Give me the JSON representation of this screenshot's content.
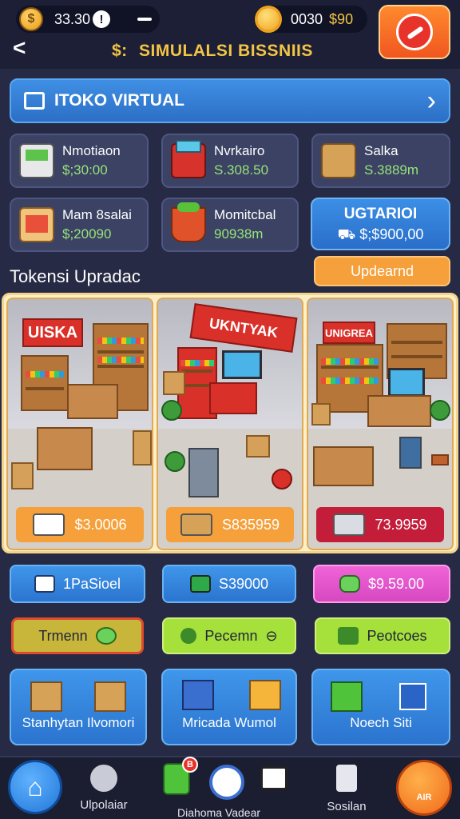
{
  "status": {
    "coins": "33.30",
    "coin_symbol": "$",
    "alert_symbol": "!",
    "gems": "0030",
    "gems_extra": "$90"
  },
  "header": {
    "back_symbol": "<",
    "title_prefix": "$:",
    "title": "SIMULALSI BISSNIIS"
  },
  "banner": {
    "title": "ITOKO VIRTUAL",
    "chevron": "›"
  },
  "stats": [
    {
      "name": "Nmotiaon",
      "value": "$;30:00",
      "icon": "cart-icon"
    },
    {
      "name": "Nvrkairo",
      "value": "S.308.50",
      "icon": "basket-icon"
    },
    {
      "name": "Salka",
      "value": "S.3889m",
      "icon": "box-icon"
    },
    {
      "name": "Mam 8salai",
      "value": "$;20090",
      "icon": "shop-icon"
    },
    {
      "name": "Momitcbal",
      "value": "90938m",
      "icon": "produce-icon"
    }
  ],
  "upgrade_card": {
    "title": "UGTARIOI",
    "value": "$;$900,00",
    "icon_symbol": "⛟"
  },
  "section": {
    "title": "Tokensi Upradac",
    "button": "Updearnd"
  },
  "stores": [
    {
      "sign": "UISKA",
      "price": "$3.0006",
      "color": "#f5a03a"
    },
    {
      "sign": "UKNTYAK",
      "price": "S835959",
      "color": "#f5a03a"
    },
    {
      "sign": "UNIGREA",
      "price": "73.9959",
      "color": "#c41d3a"
    }
  ],
  "actions_row1": [
    {
      "label": "1PaSioel",
      "icon": "list-icon"
    },
    {
      "label": "S39000",
      "icon": "chart-icon"
    },
    {
      "label": "$9.59.00",
      "icon": "bag-icon"
    }
  ],
  "actions_row2": [
    {
      "label": "Trmenn",
      "icon": "map-icon"
    },
    {
      "label": "Pecemn",
      "icon": "key-icon",
      "suffix": "⊖"
    },
    {
      "label": "Peotcoes",
      "icon": "puzzle-icon"
    }
  ],
  "big_buttons": [
    {
      "label": "Stanhytan Ilvomori",
      "icon": "crates-icon"
    },
    {
      "label": "Mricada Wumol",
      "icon": "device-icon"
    },
    {
      "label": "Noech Siti",
      "icon": "cube-icon"
    }
  ],
  "nav": {
    "home_symbol": "⌂",
    "item1_label": "Ulpolaiar",
    "item2_label": "Diahoma Vadear",
    "item2_badge": "B",
    "item3_label": "Sosilan",
    "right_label": "AIR"
  },
  "colors": {
    "background": "#262a44",
    "accent_blue": "#3f8fe4",
    "accent_orange": "#f5a03a",
    "value_green": "#98e37a",
    "title_gold": "#f3c545"
  }
}
